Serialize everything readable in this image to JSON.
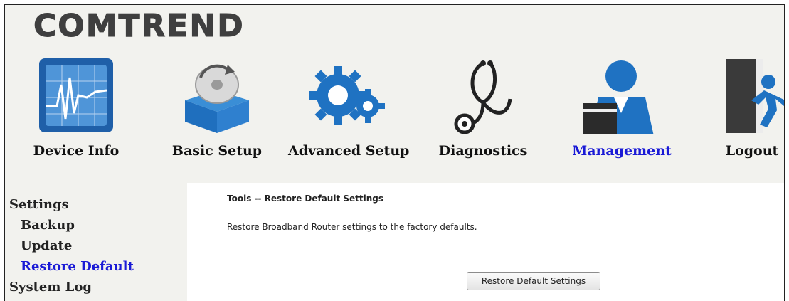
{
  "brand": {
    "logo_text": "COMTREND"
  },
  "nav": {
    "items": [
      {
        "label": "Device Info",
        "icon": "device-info-icon",
        "active": false
      },
      {
        "label": "Basic Setup",
        "icon": "basic-setup-icon",
        "active": false
      },
      {
        "label": "Advanced Setup",
        "icon": "advanced-setup-icon",
        "active": false
      },
      {
        "label": "Diagnostics",
        "icon": "diagnostics-icon",
        "active": false
      },
      {
        "label": "Management",
        "icon": "management-icon",
        "active": true
      },
      {
        "label": "Logout",
        "icon": "logout-icon",
        "active": false
      }
    ]
  },
  "sidebar": {
    "items": [
      {
        "label": "Settings",
        "level": 0,
        "active": false
      },
      {
        "label": "Backup",
        "level": 1,
        "active": false
      },
      {
        "label": "Update",
        "level": 1,
        "active": false
      },
      {
        "label": "Restore Default",
        "level": 1,
        "active": true
      },
      {
        "label": "System Log",
        "level": 0,
        "active": false
      }
    ]
  },
  "main": {
    "title": "Tools -- Restore Default Settings",
    "description": "Restore Broadband Router settings to the factory defaults.",
    "button_label": "Restore Default Settings"
  },
  "colors": {
    "active_link": "#1a1ad6",
    "icon_blue": "#1f72c2",
    "background": "#f2f2ee"
  }
}
